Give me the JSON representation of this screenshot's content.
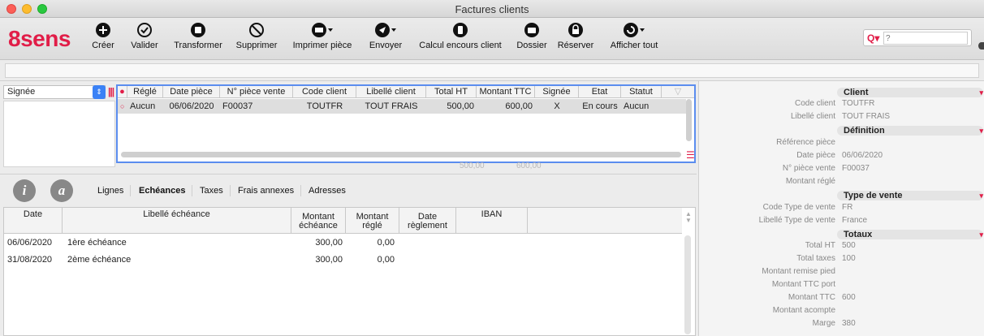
{
  "window": {
    "title": "Factures clients"
  },
  "app": {
    "logo": "8sens"
  },
  "toolbar": {
    "create": "Créer",
    "validate": "Valider",
    "transform": "Transformer",
    "delete": "Supprimer",
    "print": "Imprimer pièce",
    "send": "Envoyer",
    "outstanding": "Calcul encours client",
    "folder": "Dossier",
    "reserve": "Réserver",
    "show_all": "Afficher tout"
  },
  "search": {
    "placeholder": "?"
  },
  "filter": {
    "selected": "Signée"
  },
  "invoice_grid": {
    "headers": [
      "Réglé",
      "Date pièce",
      "N° pièce vente",
      "Code client",
      "Libellé client",
      "Total HT",
      "Montant TTC",
      "Signée",
      "Etat",
      "Statut"
    ],
    "rows": [
      {
        "regle": "Aucun",
        "date": "06/06/2020",
        "numero": "F00037",
        "code": "TOUTFR",
        "libelle": "TOUT FRAIS",
        "total_ht": "500,00",
        "ttc": "600,00",
        "signee": "X",
        "etat": "En cours",
        "statut": "Aucun"
      }
    ],
    "totals": {
      "total_ht": "500,00",
      "ttc": "600,00"
    }
  },
  "tabs": {
    "info_icon": "i",
    "a_icon": "a",
    "items": [
      "Lignes",
      "Echéances",
      "Taxes",
      "Frais annexes",
      "Adresses"
    ],
    "active": "Echéances"
  },
  "schedule": {
    "headers": {
      "date": "Date",
      "libelle": "Libellé échéance",
      "montant_1": "Montant",
      "montant_2": "échéance",
      "regle_1": "Montant",
      "regle_2": "réglé",
      "date_reg_1": "Date",
      "date_reg_2": "règlement",
      "iban": "IBAN"
    },
    "rows": [
      {
        "date": "06/06/2020",
        "libelle": "1ère échéance",
        "montant": "300,00",
        "regle": "0,00"
      },
      {
        "date": "31/08/2020",
        "libelle": "2ème échéance",
        "montant": "300,00",
        "regle": "0,00"
      }
    ]
  },
  "detail": {
    "client": {
      "title": "Client",
      "code_label": "Code client",
      "code_value": "TOUTFR",
      "libelle_label": "Libellé client",
      "libelle_value": "TOUT FRAIS"
    },
    "definition": {
      "title": "Définition",
      "ref_label": "Référence pièce",
      "date_label": "Date pièce",
      "date_value": "06/06/2020",
      "num_label": "N° pièce vente",
      "num_value": "F00037",
      "regle_label": "Montant réglé"
    },
    "type_vente": {
      "title": "Type de vente",
      "code_label": "Code Type de vente",
      "code_value": "FR",
      "libelle_label": "Libellé Type de vente",
      "libelle_value": "France"
    },
    "totaux": {
      "title": "Totaux",
      "ht_label": "Total HT",
      "ht_value": "500",
      "taxes_label": "Total taxes",
      "taxes_value": "100",
      "remise_label": "Montant remise pied",
      "port_label": "Montant TTC port",
      "ttc_label": "Montant TTC",
      "ttc_value": "600",
      "acompte_label": "Montant acompte",
      "marge_label": "Marge",
      "marge_value": "380"
    }
  }
}
